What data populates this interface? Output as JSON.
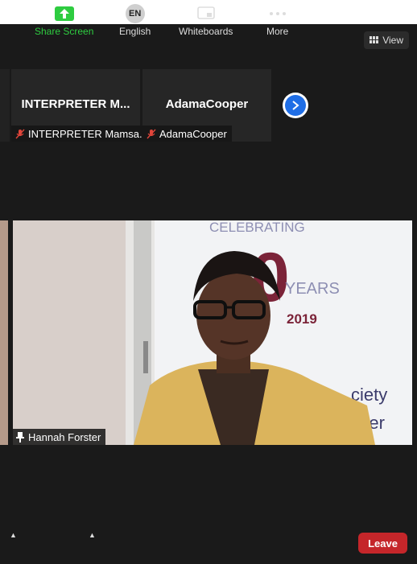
{
  "view_button": {
    "label": "View",
    "icon": "grid-icon"
  },
  "gallery": {
    "tiles": [
      {
        "display_name": "INTERPRETER M...",
        "label": "INTERPRETER Mamsa...",
        "muted": true
      },
      {
        "display_name": "AdamaCooper",
        "label": "AdamaCooper",
        "muted": true
      }
    ],
    "next_icon": "chevron-right-icon"
  },
  "active_speaker": {
    "name": "Hannah Forster",
    "pinned": true
  },
  "background_banner": {
    "line1": "CELEBRATING",
    "number": "20",
    "years": "YEARS",
    "year": "2019",
    "text1": "ciety",
    "text2": "ater"
  },
  "toolbar": {
    "share_screen": "Share Screen",
    "language_badge": "EN",
    "language": "English",
    "whiteboards": "Whiteboards",
    "more": "More",
    "leave": "Leave"
  },
  "colors": {
    "accent_blue": "#1f6ee6",
    "share_green": "#2ecc40",
    "leave_red": "#c5262a",
    "tile_bg": "#262626"
  }
}
